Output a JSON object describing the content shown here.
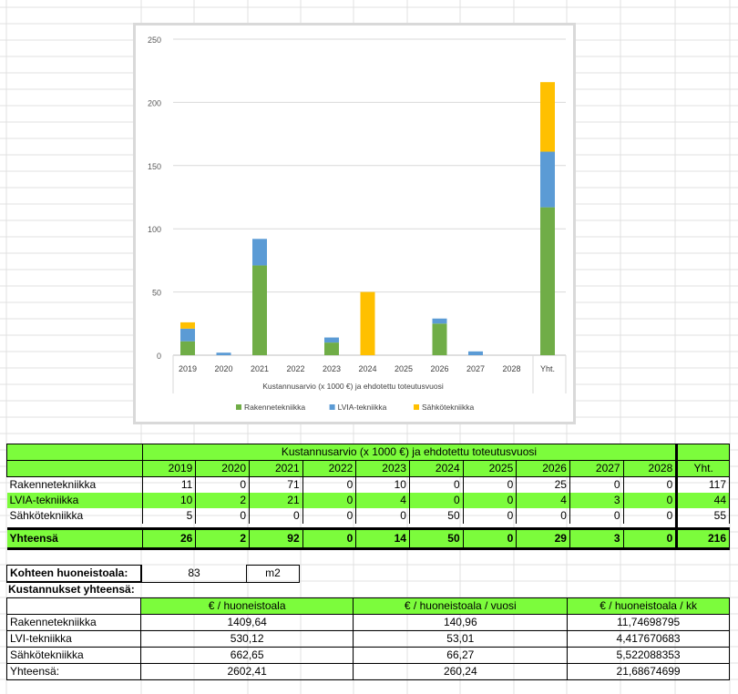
{
  "chart_data": {
    "type": "bar",
    "stacked": true,
    "categories": [
      "2019",
      "2020",
      "2021",
      "2022",
      "2023",
      "2024",
      "2025",
      "2026",
      "2027",
      "2028"
    ],
    "total_category": "Yht.",
    "series": [
      {
        "name": "Rakennetekniikka",
        "color": "#70ad47",
        "values": [
          11,
          0,
          71,
          0,
          10,
          0,
          0,
          25,
          0,
          0
        ],
        "total": 117
      },
      {
        "name": "LVIA-tekniikka",
        "color": "#5b9bd5",
        "values": [
          10,
          2,
          21,
          0,
          4,
          0,
          0,
          4,
          3,
          0
        ],
        "total": 44
      },
      {
        "name": "Sähkötekniikka",
        "color": "#ffc000",
        "values": [
          5,
          0,
          0,
          0,
          0,
          50,
          0,
          0,
          0,
          0
        ],
        "total": 55
      }
    ],
    "xlabel": "Kustannusarvio (x 1000 €) ja ehdotettu toteutusvuosi",
    "ylim": [
      0,
      250
    ],
    "yticks": [
      0,
      50,
      100,
      150,
      200,
      250
    ],
    "grid": true,
    "legend": "bottom"
  },
  "main_table": {
    "header": "Kustannusarvio (x 1000 €) ja ehdotettu toteutusvuosi",
    "years": [
      "2019",
      "2020",
      "2021",
      "2022",
      "2023",
      "2024",
      "2025",
      "2026",
      "2027",
      "2028"
    ],
    "total_label": "Yht.",
    "rows": [
      {
        "label": "Rakennetekniikka",
        "values": [
          "11",
          "0",
          "71",
          "0",
          "10",
          "0",
          "0",
          "25",
          "0",
          "0"
        ],
        "total": "117",
        "green": false
      },
      {
        "label": "LVIA-tekniikka",
        "values": [
          "10",
          "2",
          "21",
          "0",
          "4",
          "0",
          "0",
          "4",
          "3",
          "0"
        ],
        "total": "44",
        "green": true
      },
      {
        "label": "Sähkötekniikka",
        "values": [
          "5",
          "0",
          "0",
          "0",
          "0",
          "50",
          "0",
          "0",
          "0",
          "0"
        ],
        "total": "55",
        "green": false
      }
    ],
    "sum_row": {
      "label": "Yhteensä",
      "values": [
        "26",
        "2",
        "92",
        "0",
        "14",
        "50",
        "0",
        "29",
        "3",
        "0"
      ],
      "total": "216"
    }
  },
  "area": {
    "label": "Kohteen huoneistoala:",
    "value": "83",
    "unit": "m2"
  },
  "costs": {
    "title": "Kustannukset yhteensä:",
    "headers": [
      "€ / huoneistoala",
      "€ / huoneistoala / vuosi",
      "€ / huoneistoala / kk"
    ],
    "rows": [
      {
        "label": "Rakennetekniikka",
        "values": [
          "1409,64",
          "140,96",
          "11,74698795"
        ]
      },
      {
        "label": "LVI-tekniikka",
        "values": [
          "530,12",
          "53,01",
          "4,417670683"
        ]
      },
      {
        "label": "Sähkötekniikka",
        "values": [
          "662,65",
          "66,27",
          "5,522088353"
        ]
      },
      {
        "label": "Yhteensä:",
        "values": [
          "2602,41",
          "260,24",
          "21,68674699"
        ]
      }
    ]
  }
}
